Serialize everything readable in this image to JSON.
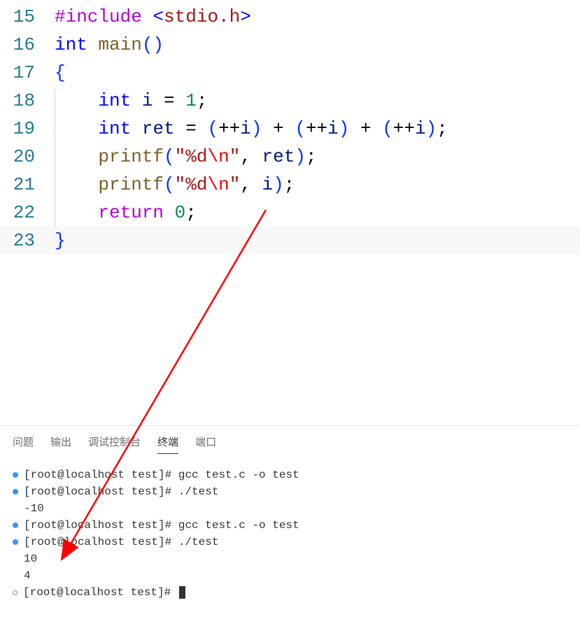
{
  "editor": {
    "lines": [
      {
        "num": "15"
      },
      {
        "num": "16"
      },
      {
        "num": "17"
      },
      {
        "num": "18"
      },
      {
        "num": "19"
      },
      {
        "num": "20"
      },
      {
        "num": "21"
      },
      {
        "num": "22"
      },
      {
        "num": "23"
      }
    ],
    "tokens": {
      "include": "#include",
      "lt": "<",
      "stdio": "stdio.h",
      "gt": ">",
      "int": "int",
      "main": "main",
      "lparen": "(",
      "rparen": ")",
      "lbrace": "{",
      "rbrace": "}",
      "i": "i",
      "eq": " = ",
      "one": "1",
      "semi": ";",
      "ret": "ret",
      "plusplus": "++",
      "plus": " + ",
      "printf": "printf",
      "quote": "\"",
      "pct_d": "%d",
      "esc_n": "\\n",
      "comma": ", ",
      "return": "return",
      "zero": "0",
      "space4": "    "
    }
  },
  "tabs": {
    "problems": "问题",
    "output": "输出",
    "debug": "调试控制台",
    "terminal": "终端",
    "ports": "端口"
  },
  "terminal": {
    "lines": [
      {
        "bullet": "filled",
        "text": "[root@localhost test]# gcc test.c -o test"
      },
      {
        "bullet": "filled",
        "text": "[root@localhost test]# ./test"
      },
      {
        "bullet": "none",
        "text": "-10"
      },
      {
        "bullet": "filled",
        "text": "[root@localhost test]# gcc test.c -o test"
      },
      {
        "bullet": "filled",
        "text": "[root@localhost test]# ./test"
      },
      {
        "bullet": "none",
        "text": "10"
      },
      {
        "bullet": "none",
        "text": "4"
      },
      {
        "bullet": "empty",
        "text": "[root@localhost test]# ",
        "cursor": true
      }
    ]
  }
}
